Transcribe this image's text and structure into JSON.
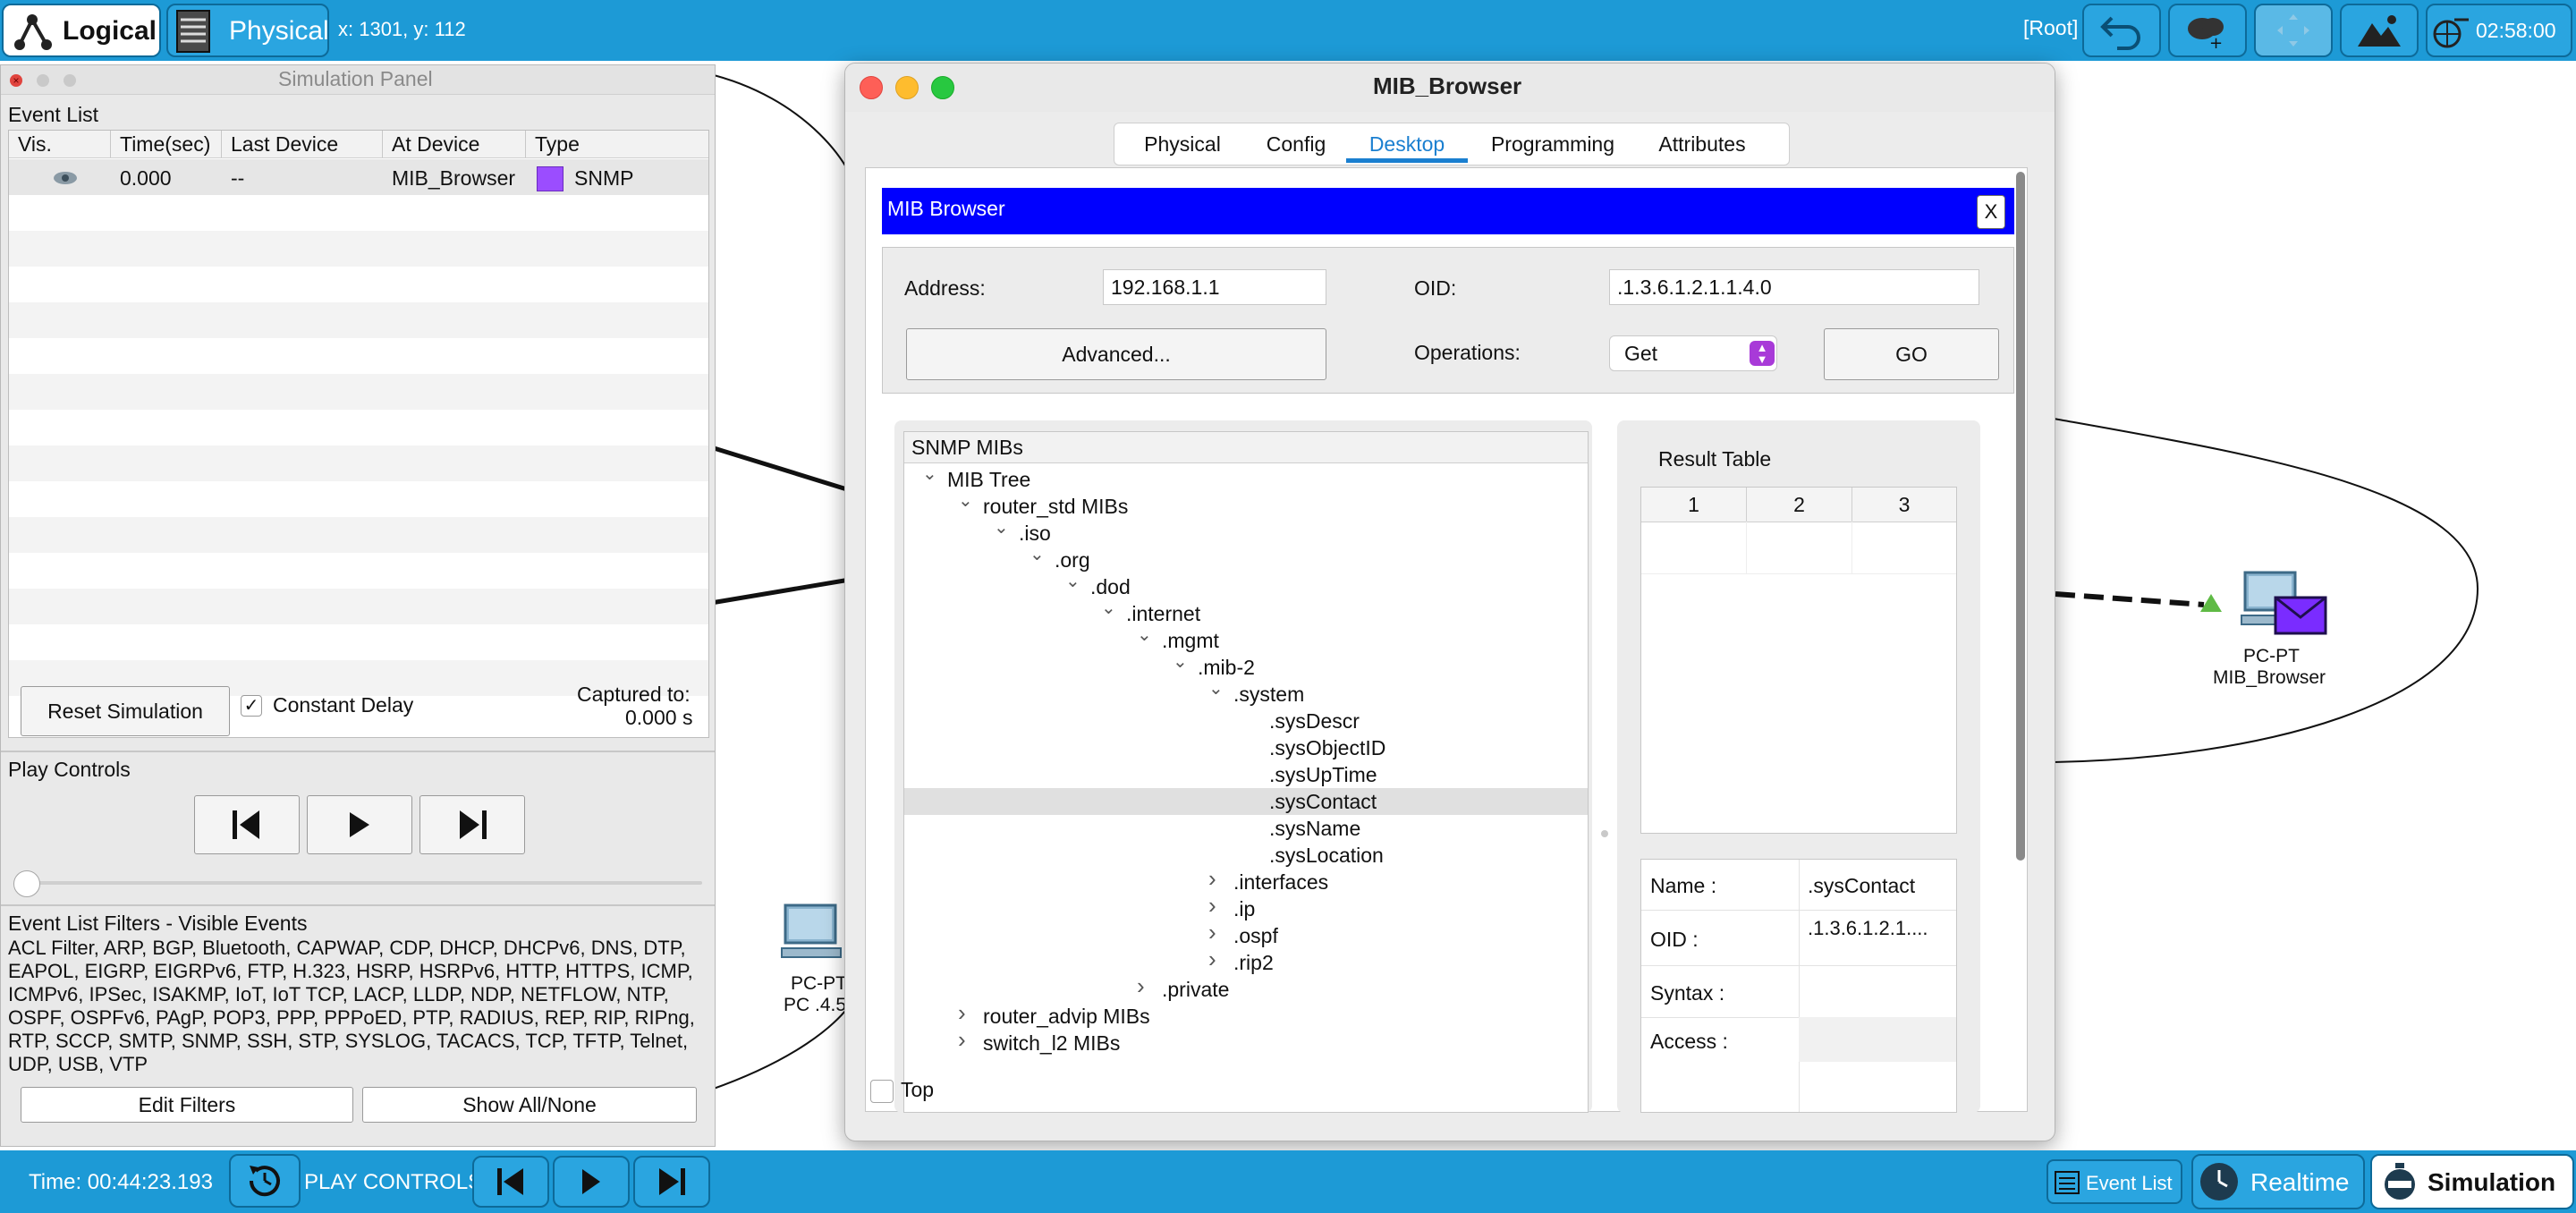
{
  "topbar": {
    "logical_label": "Logical",
    "physical_label": "Physical",
    "coords": "x: 1301, y: 112",
    "root_label": "[Root]",
    "clock": "02:58:00"
  },
  "bottombar": {
    "time": "Time: 00:44:23.193",
    "play_controls_label": "PLAY CONTROLS:",
    "event_list_label": "Event List",
    "realtime_label": "Realtime",
    "simulation_label": "Simulation"
  },
  "sim_panel": {
    "title": "Simulation Panel",
    "event_list_label": "Event List",
    "columns": [
      "Vis.",
      "Time(sec)",
      "Last Device",
      "At Device",
      "Type"
    ],
    "events": [
      {
        "vis": "eye",
        "time": "0.000",
        "last_device": "--",
        "at_device": "MIB_Browser",
        "type": "SNMP",
        "type_color": "#9b4dff"
      }
    ],
    "reset_label": "Reset Simulation",
    "constant_delay_label": "Constant Delay",
    "constant_delay_checked": true,
    "captured_label": "Captured to:",
    "captured_value": "0.000 s",
    "play_controls_label": "Play Controls",
    "filters_label": "Event List Filters - Visible Events",
    "filters_text": "ACL Filter, ARP, BGP, Bluetooth, CAPWAP, CDP, DHCP, DHCPv6, DNS, DTP, EAPOL, EIGRP, EIGRPv6, FTP, H.323, HSRP, HSRPv6, HTTP, HTTPS, ICMP, ICMPv6, IPSec, ISAKMP, IoT, IoT TCP, LACP, LLDP, NDP, NETFLOW, NTP, OSPF, OSPFv6, PAgP, POP3, PPP, PPPoED, PTP, RADIUS, REP, RIP, RIPng, RTP, SCCP, SMTP, SNMP, SSH, STP, SYSLOG, TACACS, TCP, TFTP, Telnet, UDP, USB, VTP",
    "edit_filters_label": "Edit Filters",
    "show_all_label": "Show All/None"
  },
  "mib_window": {
    "title": "MIB_Browser",
    "tabs": [
      "Physical",
      "Config",
      "Desktop",
      "Programming",
      "Attributes"
    ],
    "active_tab": "Desktop",
    "app_header": "MIB Browser",
    "close_label": "X",
    "address_label": "Address:",
    "address_value": "192.168.1.1",
    "oid_label": "OID:",
    "oid_value": ".1.3.6.1.2.1.1.4.0",
    "advanced_label": "Advanced...",
    "operations_label": "Operations:",
    "operation_value": "Get",
    "go_label": "GO",
    "tree_header": "SNMP MIBs",
    "tree": [
      {
        "label": "MIB Tree",
        "level": 0,
        "state": "open"
      },
      {
        "label": "router_std MIBs",
        "level": 1,
        "state": "open"
      },
      {
        "label": ".iso",
        "level": 2,
        "state": "open"
      },
      {
        "label": ".org",
        "level": 3,
        "state": "open"
      },
      {
        "label": ".dod",
        "level": 4,
        "state": "open"
      },
      {
        "label": ".internet",
        "level": 5,
        "state": "open"
      },
      {
        "label": ".mgmt",
        "level": 6,
        "state": "open"
      },
      {
        "label": ".mib-2",
        "level": 7,
        "state": "open"
      },
      {
        "label": ".system",
        "level": 8,
        "state": "open"
      },
      {
        "label": ".sysDescr",
        "level": 9,
        "state": "leaf"
      },
      {
        "label": ".sysObjectID",
        "level": 9,
        "state": "leaf"
      },
      {
        "label": ".sysUpTime",
        "level": 9,
        "state": "leaf"
      },
      {
        "label": ".sysContact",
        "level": 9,
        "state": "leaf",
        "selected": true
      },
      {
        "label": ".sysName",
        "level": 9,
        "state": "leaf"
      },
      {
        "label": ".sysLocation",
        "level": 9,
        "state": "leaf"
      },
      {
        "label": ".interfaces",
        "level": 8,
        "state": "closed"
      },
      {
        "label": ".ip",
        "level": 8,
        "state": "closed"
      },
      {
        "label": ".ospf",
        "level": 8,
        "state": "closed"
      },
      {
        "label": ".rip2",
        "level": 8,
        "state": "closed"
      },
      {
        "label": ".private",
        "level": 6,
        "state": "closed"
      },
      {
        "label": "router_advip MIBs",
        "level": 1,
        "state": "closed"
      },
      {
        "label": "switch_l2 MIBs",
        "level": 1,
        "state": "closed"
      }
    ],
    "result_table_label": "Result Table",
    "result_columns": [
      "1",
      "2",
      "3"
    ],
    "props": [
      {
        "key": "Name :",
        "value": ".sysContact"
      },
      {
        "key": "OID :",
        "value": ".1.3.6.1.2.1...."
      },
      {
        "key": "Syntax :",
        "value": ""
      },
      {
        "key": "Access :",
        "value": ""
      }
    ],
    "top_checkbox_label": "Top"
  },
  "devices": [
    {
      "name": "PC-PT",
      "label": "MIB_Browser"
    },
    {
      "name": "PC-PT",
      "label": "PC .4.5"
    }
  ]
}
